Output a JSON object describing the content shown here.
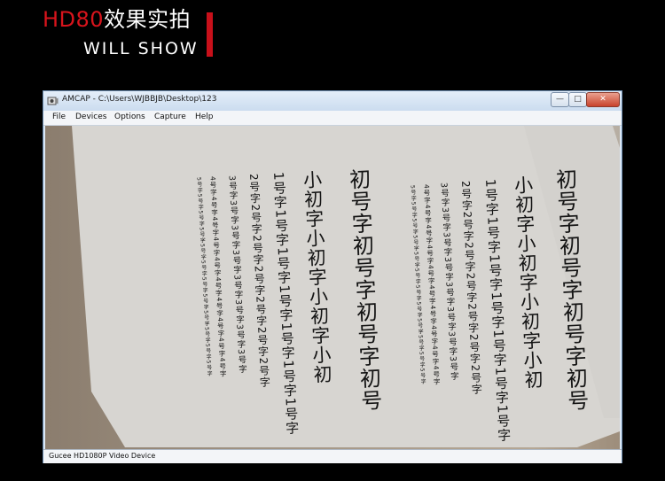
{
  "banner": {
    "model": "HD80",
    "title_rest": "效果实拍",
    "subtitle": "WILL SHOW",
    "accent_color": "#d8141c"
  },
  "window": {
    "title": "AMCAP - C:\\Users\\WJBBJB\\Desktop\\123",
    "app_icon": "camera-app-icon",
    "buttons": {
      "minimize": "—",
      "maximize": "□",
      "close": "✕"
    },
    "menu": [
      "File",
      "Devices",
      "Options",
      "Capture",
      "Help"
    ],
    "status": "Gucee HD1080P Video Device"
  },
  "paper": {
    "columns": [
      {
        "text": "初号字初号字初号字初号",
        "size": 24
      },
      {
        "text": "小初字小初字小初字小初",
        "size": 21
      },
      {
        "text": "1号字1号字1号字1号字1号字1号字1号字",
        "size": 15
      },
      {
        "text": "2号字2号字2号字2号字2号字2号字2号字",
        "size": 12
      },
      {
        "text": "3号字3号字3号字3号字3号字3号字3号字3号字",
        "size": 9.5
      },
      {
        "text": "4号字4号字4号字4号字4号字4号字4号字4号字4号字4号字",
        "size": 7.5
      },
      {
        "text": "5号字5号字5号字5号字5号字5号字5号字5号字5号字5号字5号字5号字",
        "size": 6
      },
      {
        "text": "初号字初号字初号字初号",
        "size": 24
      },
      {
        "text": "小初字小初字小初字小初",
        "size": 21
      },
      {
        "text": "1号字1号字1号字1号字1号字1号字1号字",
        "size": 15
      },
      {
        "text": "2号字2号字2号字2号字2号字2号字2号字",
        "size": 12
      },
      {
        "text": "3号字3号字3号字3号字3号字3号字3号字3号字",
        "size": 9.5
      },
      {
        "text": "4号字4号字4号字4号字4号字4号字4号字4号字4号字4号字",
        "size": 7.5
      },
      {
        "text": "5号字5号字5号字5号字5号字5号字5号字5号字5号字5号字5号字5号字",
        "size": 6
      }
    ]
  }
}
